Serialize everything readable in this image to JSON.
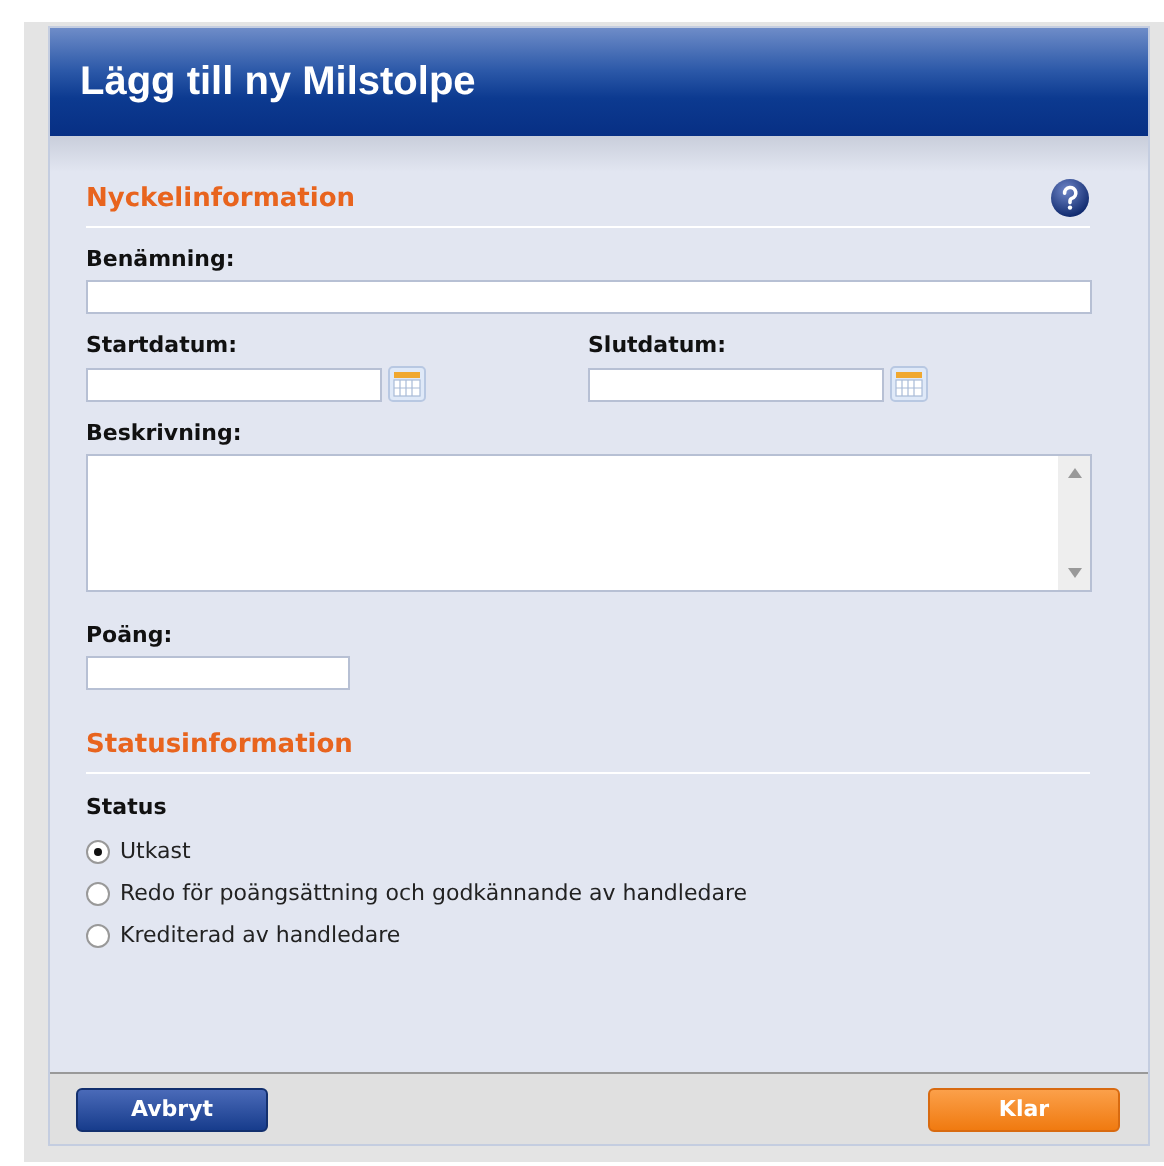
{
  "dialog": {
    "title": "Lägg till ny Milstolpe"
  },
  "key_section": {
    "heading": "Nyckelinformation",
    "name_field": {
      "label": "Benämning:"
    },
    "start_date": {
      "label": "Startdatum:"
    },
    "end_date": {
      "label": "Slutdatum:"
    },
    "description": {
      "label": "Beskrivning:"
    },
    "points": {
      "label": "Poäng:"
    }
  },
  "status_section": {
    "heading": "Statusinformation",
    "label": "Status",
    "options": [
      {
        "label": "Utkast",
        "selected": true
      },
      {
        "label": "Redo för poängsättning och godkännande av handledare",
        "selected": false
      },
      {
        "label": "Krediterad av handledare",
        "selected": false
      }
    ]
  },
  "buttons": [
    {
      "label": "Avbryt",
      "kind": "cancel"
    },
    {
      "label": "Klar",
      "kind": "primary"
    }
  ]
}
